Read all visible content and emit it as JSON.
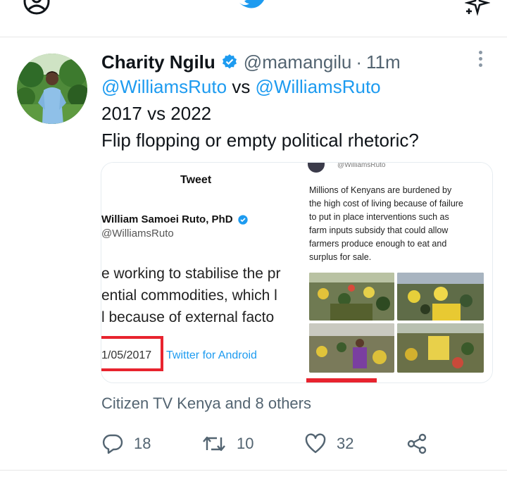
{
  "topbar": {
    "left_icon": "profile-icon",
    "center_icon": "twitter-bird-icon",
    "right_icon": "sparkle-icon",
    "brand_color": "#1d9bf0"
  },
  "tweet": {
    "author_name": "Charity Ngilu",
    "handle": "@mamangilu",
    "separator": "·",
    "time": "11m",
    "mention_1": "@WilliamsRuto",
    "vs_text": "vs",
    "mention_2": "@WilliamsRuto",
    "line_2": "2017 vs 2022",
    "line_3": "Flip flopping or empty political rhetoric?"
  },
  "media": {
    "left": {
      "header": "Tweet",
      "name": "William Samoei Ruto, PhD",
      "handle": "@WilliamsRuto",
      "text_lines": [
        "e working to stabilise the pr",
        "ential commodities, which l",
        "l because of external facto"
      ],
      "date": "1/05/2017",
      "source": "Twitter for Android"
    },
    "right": {
      "handle": "@WilliamsRuto",
      "text_lines": [
        "Millions of Kenyans are burdened by",
        "the high cost of living because of failure",
        "to put in place interventions such as",
        "farm inputs subsidy that could allow",
        "farmers produce enough to eat and",
        "surplus for sale."
      ]
    },
    "highlight_color": "#e8232e"
  },
  "social_context": "Citizen TV Kenya and 8 others",
  "actions": {
    "reply_count": "18",
    "retweet_count": "10",
    "like_count": "32"
  }
}
